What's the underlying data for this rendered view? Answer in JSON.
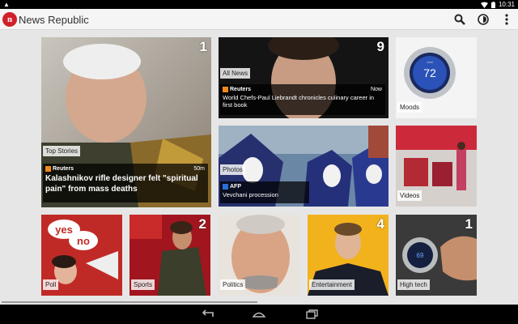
{
  "status_bar": {
    "time": "10:31",
    "warning_icon": "warning-icon",
    "wifi_icon": "wifi-icon",
    "battery_icon": "battery-icon"
  },
  "action_bar": {
    "app_title": "News Republic",
    "logo_letter": "n",
    "search_icon": "search-icon",
    "profile_icon": "profile-icon",
    "overflow_icon": "overflow-menu-icon"
  },
  "tiles": {
    "top_stories": {
      "category": "Top Stories",
      "count": "1",
      "source": "Reuters",
      "age": "50m",
      "headline": "Kalashnikov rifle designer felt \"spiritual pain\" from mass deaths"
    },
    "all_news": {
      "category": "All News",
      "count": "9",
      "source": "Reuters",
      "age": "Now",
      "headline": "World Chefs-Paul Liebrandt chronicles culinary career in first book"
    },
    "moods": {
      "category": "Moods",
      "thermostat_label": "nest",
      "thermostat_value": "72"
    },
    "photos": {
      "category": "Photos",
      "source": "AFP",
      "headline": "Vevchani procession"
    },
    "videos": {
      "category": "Videos"
    },
    "poll": {
      "category": "Poll",
      "sign_word_1": "yes",
      "sign_word_2": "no"
    },
    "sports": {
      "category": "Sports",
      "count": "2"
    },
    "politics": {
      "category": "Politics"
    },
    "entertainment": {
      "category": "Entertainment",
      "count": "4"
    },
    "high_tech": {
      "category": "High tech",
      "count": "1",
      "thermostat_value": "69"
    }
  },
  "colors": {
    "brand_red": "#d0202a",
    "reuters_orange": "#f28a1b",
    "afp_blue": "#2a6fd6"
  }
}
